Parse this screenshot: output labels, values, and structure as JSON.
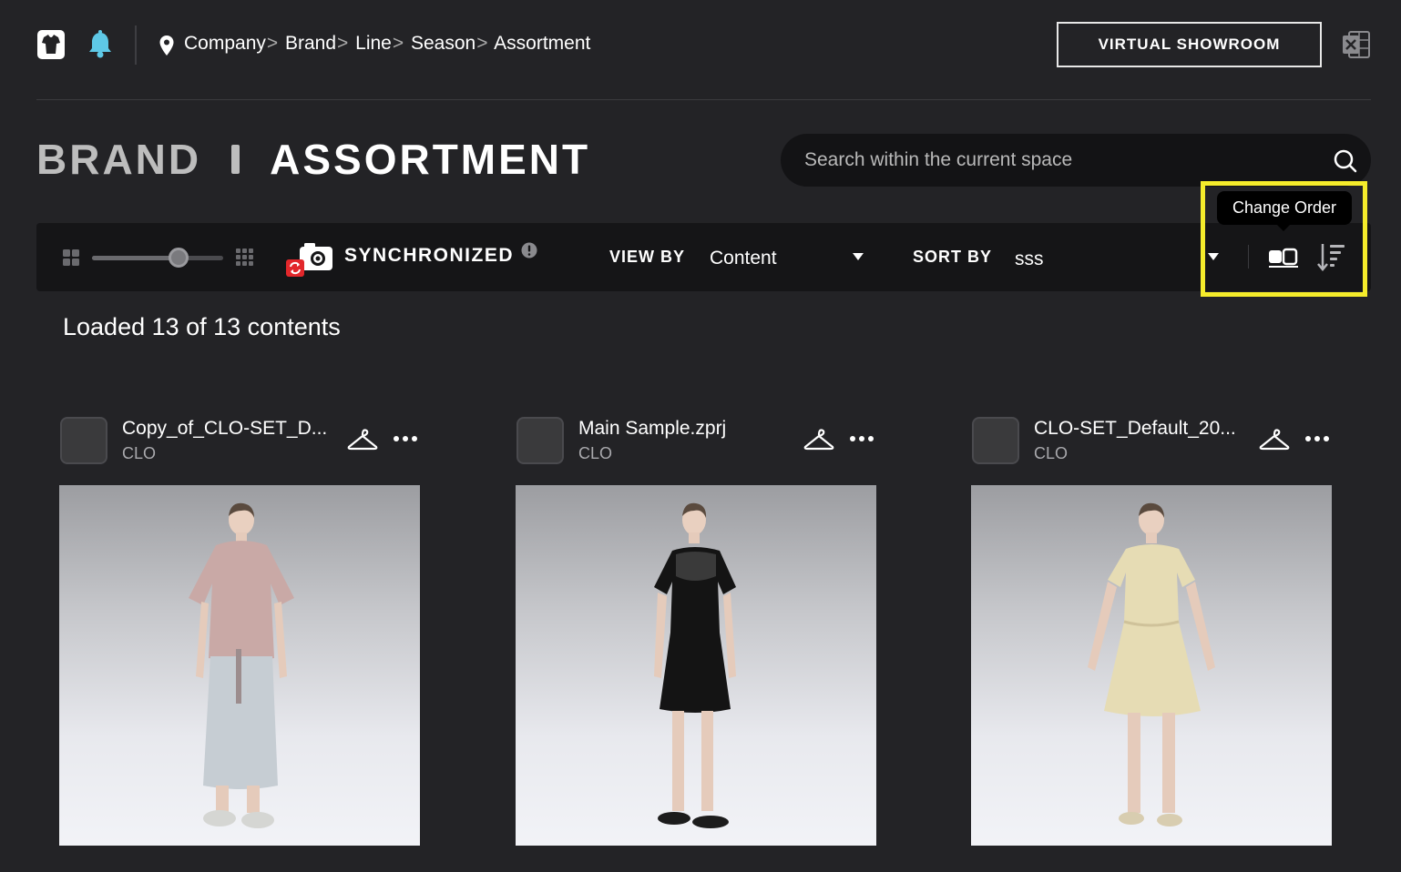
{
  "header": {
    "breadcrumb": [
      "Company",
      "Brand",
      "Line",
      "Season",
      "Assortment"
    ],
    "breadcrumb_separator": ">",
    "virtual_showroom_label": "VIRTUAL SHOWROOM"
  },
  "title": {
    "brand": "BRAND",
    "page": "ASSORTMENT"
  },
  "search": {
    "placeholder": "Search within the current space"
  },
  "toolbar": {
    "sync_label": "SYNCHRONIZED",
    "view_by_label": "VIEW BY",
    "view_by_value": "Content",
    "sort_by_label": "SORT BY",
    "sort_by_value": "sss",
    "thumbnail_size_level": 0.66,
    "change_order_tooltip": "Change Order"
  },
  "status": {
    "loaded_text": "Loaded 13 of 13 contents"
  },
  "cards": [
    {
      "name": "Copy_of_CLO-SET_D...",
      "owner": "CLO",
      "outfit": "pink-tee-long-skirt"
    },
    {
      "name": "Main Sample.zprj",
      "owner": "CLO",
      "outfit": "black-dress"
    },
    {
      "name": "CLO-SET_Default_20...",
      "owner": "CLO",
      "outfit": "yellow-dress"
    }
  ],
  "colors": {
    "background": "#232326",
    "toolbar": "#151517",
    "highlight": "#f5ec2b",
    "bell": "#5ec8e6",
    "sync_badge": "#e2272b"
  }
}
